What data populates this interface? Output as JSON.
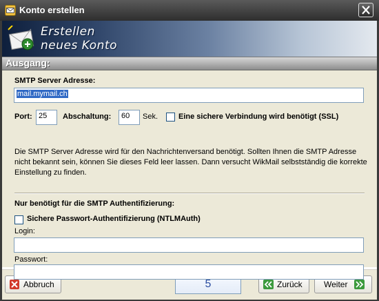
{
  "window": {
    "title": "Konto erstellen"
  },
  "banner": {
    "line1": "Erstellen",
    "line2": "neues Konto"
  },
  "section": {
    "title": "Ausgang:"
  },
  "smtp": {
    "label": "SMTP Server Adresse:",
    "value": "mail.mymail.ch",
    "port_label": "Port:",
    "port_value": "25",
    "timeout_label": "Abschaltung:",
    "timeout_value": "60",
    "timeout_unit": "Sek.",
    "ssl_label": "Eine sichere Verbindung wird benötigt (SSL)",
    "ssl_checked": false,
    "description": "Die SMTP Server Adresse wird für den Nachrichtenversand benötigt. Sollten Ihnen die SMTP Adresse nicht bekannt sein, können Sie dieses Feld leer lassen. Dann versucht WikMail selbstständig die korrekte Einstellung zu finden."
  },
  "auth": {
    "title": "Nur benötigt für die SMTP Authentifizierung:",
    "ntlm_label": "Sichere Passwort-Authentifizierung (NTLMAuth)",
    "ntlm_checked": false,
    "login_label": "Login:",
    "login_value": "",
    "password_label": "Passwort:",
    "password_value": ""
  },
  "footer": {
    "cancel_label": "Abbruch",
    "step": "5",
    "back_label": "Zurück",
    "next_label": "Weiter"
  },
  "colors": {
    "accent": "#316ac5",
    "banner_dark": "#0e1f3c",
    "step_text": "#2a4ca0"
  }
}
